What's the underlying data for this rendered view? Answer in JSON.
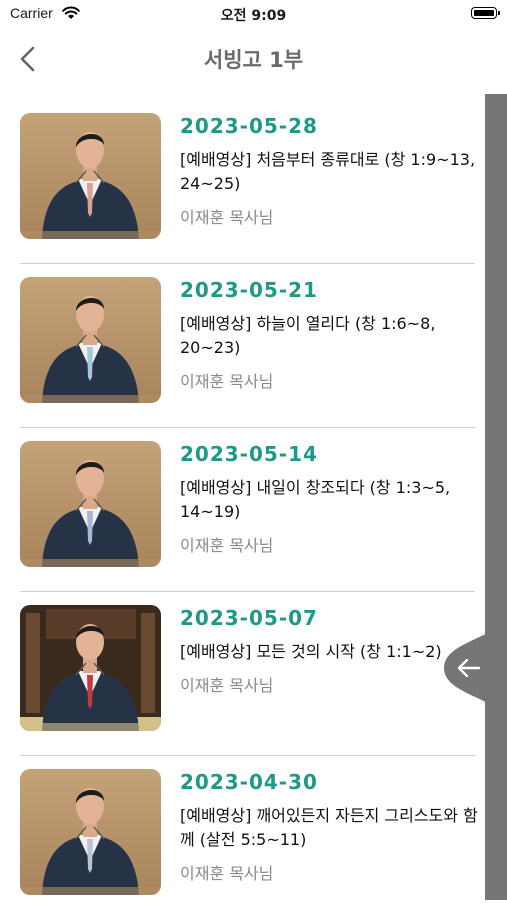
{
  "status": {
    "carrier": "Carrier",
    "time": "오전 9:09"
  },
  "nav": {
    "title": "서빙고 1부"
  },
  "sermons": [
    {
      "date": "2023-05-28",
      "title": "[예배영상] 처음부터 종류대로 (창 1:9~13, 24~25)",
      "preacher": "이재훈 목사님",
      "tie_color": "#d9a18f",
      "backdrop": "wood"
    },
    {
      "date": "2023-05-21",
      "title": "[예배영상] 하늘이 열리다 (창 1:6~8, 20~23)",
      "preacher": "이재훈 목사님",
      "tie_color": "#a6c8df",
      "backdrop": "wood"
    },
    {
      "date": "2023-05-14",
      "title": "[예배영상] 내일이 창조되다 (창 1:3~5, 14~19)",
      "preacher": "이재훈 목사님",
      "tie_color": "#a9b8cf",
      "backdrop": "wood"
    },
    {
      "date": "2023-05-07",
      "title": "[예배영상] 모든 것의 시작 (창 1:1~2)",
      "preacher": "이재훈 목사님",
      "tie_color": "#c23a3f",
      "backdrop": "chapel"
    },
    {
      "date": "2023-04-30",
      "title": "[예배영상] 깨어있든지 자든지 그리스도와 함께 (살전 5:5~11)",
      "preacher": "이재훈 목사님",
      "tie_color": "#b9c3d3",
      "backdrop": "wood"
    }
  ],
  "icons": {
    "back": "chevron-left-icon",
    "drawer": "arrow-left-icon",
    "wifi": "wifi-icon",
    "battery": "battery-icon"
  },
  "colors": {
    "accent": "#1d9a87",
    "separator": "#b9d9e6",
    "panel": "#767676"
  }
}
